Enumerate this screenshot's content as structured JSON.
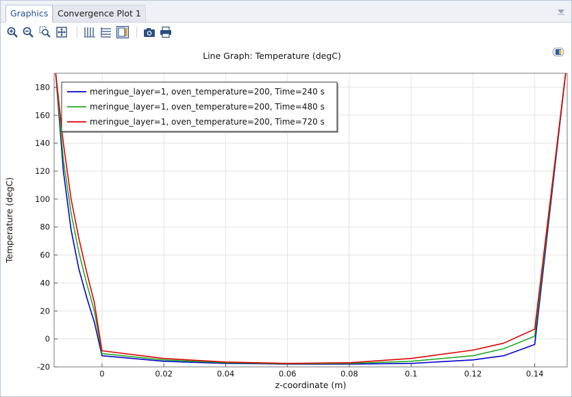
{
  "tabs": [
    {
      "label": "Graphics",
      "active": true
    },
    {
      "label": "Convergence Plot 1",
      "active": false
    }
  ],
  "toolbar": {
    "buttons": [
      "zoom-in-icon",
      "zoom-out-icon",
      "zoom-box-icon",
      "zoom-extents-icon",
      "grid-lines-icon",
      "grid-icon",
      "legend-toggle-icon",
      "camera-icon",
      "print-icon"
    ]
  },
  "chart_data": {
    "type": "line",
    "title": "Line Graph: Temperature (degC)",
    "xlabel": "z-coordinate (m)",
    "ylabel": "Temperature (degC)",
    "xlim": [
      -0.0155,
      0.1505
    ],
    "ylim": [
      -20,
      190
    ],
    "xticks": [
      0,
      0.02,
      0.04,
      0.06,
      0.08,
      0.1,
      0.12,
      0.14
    ],
    "xtick_labels": [
      "0",
      "0.02",
      "0.04",
      "0.06",
      "0.08",
      "0.1",
      "0.12",
      "0.14"
    ],
    "yticks": [
      -20,
      0,
      20,
      40,
      60,
      80,
      100,
      120,
      140,
      160,
      180
    ],
    "ytick_labels": [
      "-20",
      "0",
      "20",
      "40",
      "60",
      "80",
      "100",
      "120",
      "140",
      "160",
      "180"
    ],
    "grid": true,
    "legend_position": "top-left",
    "series": [
      {
        "name": "meringue_layer=1, oven_temperature=200, Time=240 s",
        "color": "#0000cc",
        "x": [
          -0.015,
          -0.0125,
          -0.01,
          -0.0075,
          -0.005,
          -0.0025,
          0,
          0.02,
          0.04,
          0.06,
          0.08,
          0.1,
          0.12,
          0.13,
          0.14,
          0.15
        ],
        "y": [
          190,
          120,
          78,
          50,
          30,
          12,
          -12,
          -16,
          -17.5,
          -18,
          -18,
          -17.5,
          -15,
          -12,
          -4,
          190
        ]
      },
      {
        "name": "meringue_layer=1, oven_temperature=200, Time=480 s",
        "color": "#22aa22",
        "x": [
          -0.015,
          -0.0125,
          -0.01,
          -0.0075,
          -0.005,
          -0.0025,
          0,
          0.02,
          0.04,
          0.06,
          0.08,
          0.1,
          0.12,
          0.13,
          0.14,
          0.15
        ],
        "y": [
          190,
          128,
          90,
          62,
          40,
          20,
          -10.5,
          -15,
          -17,
          -17.8,
          -17.5,
          -16,
          -12,
          -7,
          2,
          190
        ]
      },
      {
        "name": "meringue_layer=1, oven_temperature=200, Time=720 s",
        "color": "#dd0000",
        "x": [
          -0.015,
          -0.0125,
          -0.01,
          -0.0075,
          -0.005,
          -0.0025,
          0,
          0.02,
          0.04,
          0.06,
          0.08,
          0.1,
          0.12,
          0.13,
          0.14,
          0.15
        ],
        "y": [
          190,
          140,
          100,
          72,
          48,
          26,
          -8.5,
          -14,
          -16.5,
          -17.5,
          -17,
          -14,
          -8,
          -3,
          7,
          190
        ]
      }
    ]
  }
}
